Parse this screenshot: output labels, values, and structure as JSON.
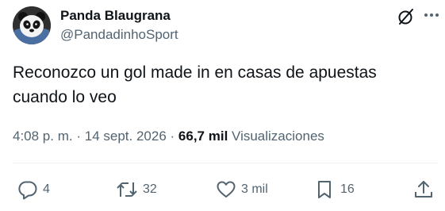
{
  "author": {
    "display_name": "Panda Blaugrana",
    "handle": "@PandadinhoSport",
    "avatar_icon": "panda-avatar"
  },
  "tweet": {
    "text": "Reconozco un gol made in en casas de apuestas cuando lo veo"
  },
  "meta": {
    "time": "4:08 p. m.",
    "date": "14 sept. 2026",
    "separator": "·",
    "views_count": "66,7 mil",
    "views_label": "Visualizaciones"
  },
  "actions": {
    "replies": "4",
    "reposts": "32",
    "likes": "3 mil",
    "bookmarks": "16"
  },
  "icons": {
    "grok": "grok-icon",
    "more": "more-icon",
    "reply": "reply-icon",
    "repost": "repost-icon",
    "like": "heart-icon",
    "bookmark": "bookmark-icon",
    "share": "share-icon"
  },
  "colors": {
    "text_primary": "#0f1419",
    "text_secondary": "#536471",
    "divider": "#eff3f4"
  }
}
